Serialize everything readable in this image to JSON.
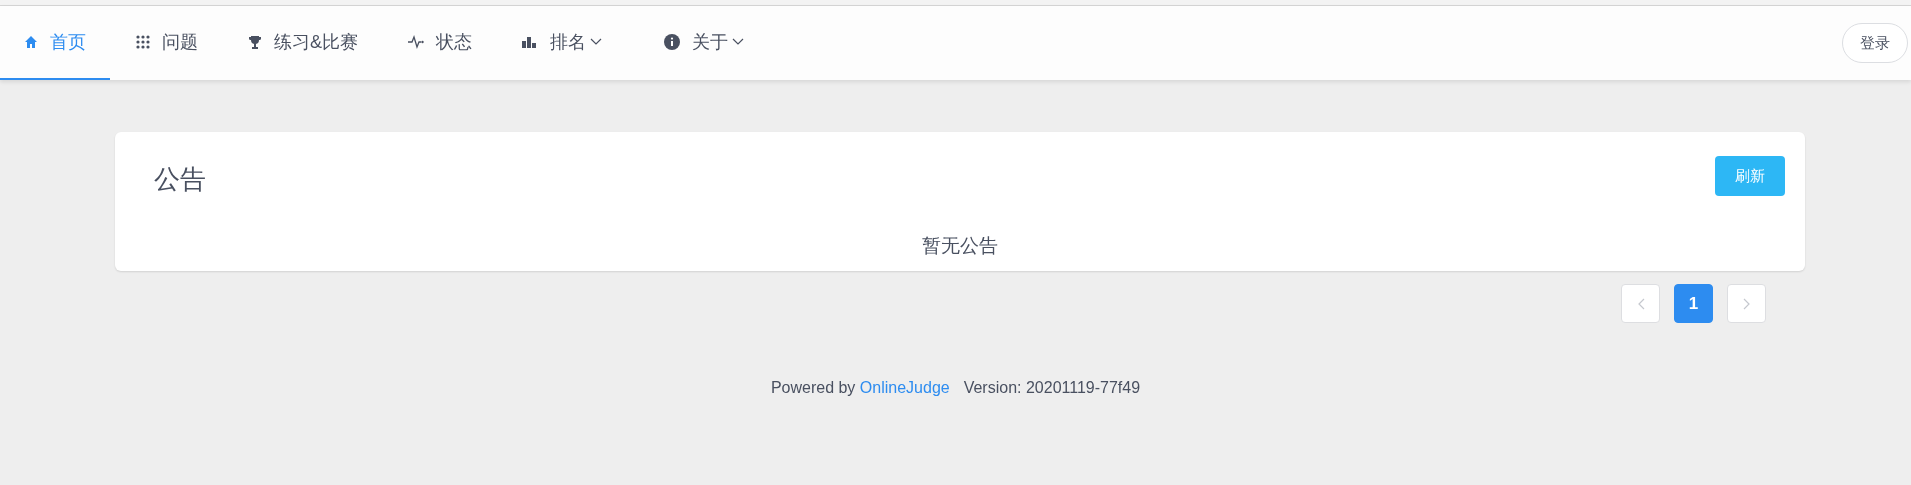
{
  "nav": {
    "items": [
      {
        "label": "首页",
        "selected": true,
        "dropdown": false
      },
      {
        "label": "问题",
        "selected": false,
        "dropdown": false
      },
      {
        "label": "练习&比赛",
        "selected": false,
        "dropdown": false
      },
      {
        "label": "状态",
        "selected": false,
        "dropdown": false
      },
      {
        "label": "排名",
        "selected": false,
        "dropdown": true
      },
      {
        "label": "关于",
        "selected": false,
        "dropdown": true
      }
    ],
    "login_button": "登录"
  },
  "announcements": {
    "title": "公告",
    "refresh_button": "刷新",
    "empty_text": "暂无公告"
  },
  "pagination": {
    "pages": [
      {
        "label": "1",
        "selected": true
      }
    ]
  },
  "footer": {
    "powered_by": "Powered by",
    "link": "OnlineJudge",
    "version": "Version: 20201119-77f49"
  }
}
